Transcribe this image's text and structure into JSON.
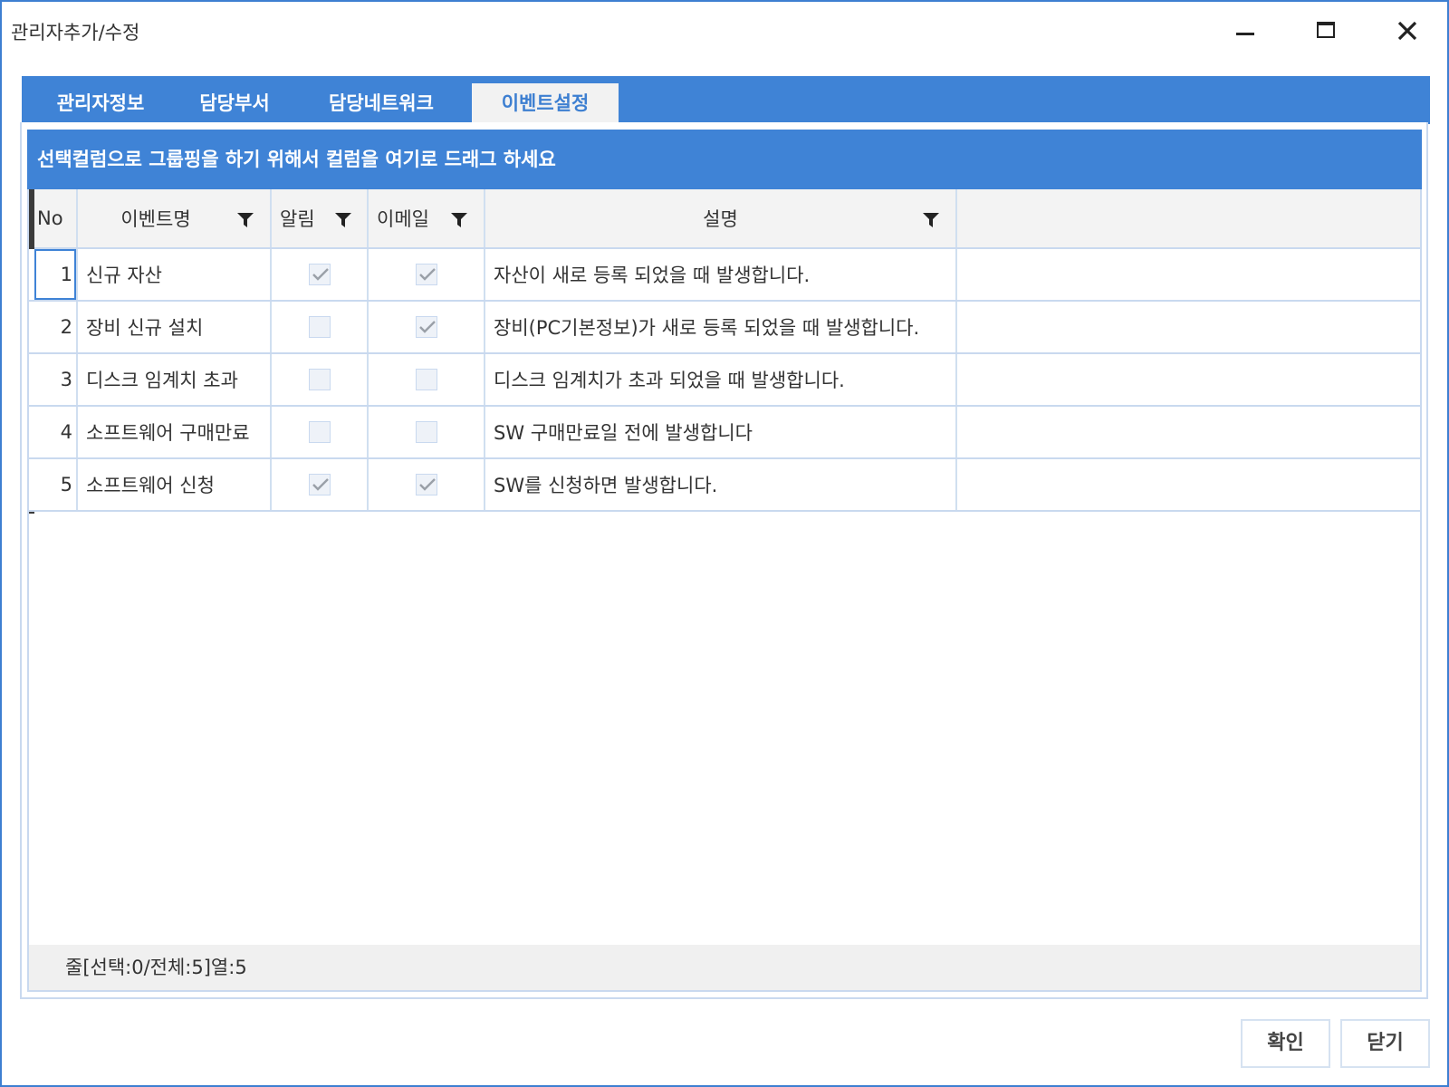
{
  "window": {
    "title": "관리자추가/수정"
  },
  "tabs": [
    {
      "label": "관리자정보",
      "active": false
    },
    {
      "label": "담당부서",
      "active": false
    },
    {
      "label": "담당네트워크",
      "active": false
    },
    {
      "label": "이벤트설정",
      "active": true
    }
  ],
  "group_panel": {
    "text": "선택컬럼으로 그룹핑을 하기 위해서 컬럼을 여기로 드래그 하세요"
  },
  "grid": {
    "columns": {
      "no": "No",
      "name": "이벤트명",
      "alert": "알림",
      "email": "이메일",
      "desc": "설명"
    },
    "rows": [
      {
        "no": "1",
        "name": "신규 자산",
        "alert": true,
        "email": true,
        "desc": "자산이 새로 등록 되었을 때 발생합니다."
      },
      {
        "no": "2",
        "name": "장비 신규 설치",
        "alert": false,
        "email": true,
        "desc": "장비(PC기본정보)가 새로 등록 되었을 때 발생합니다."
      },
      {
        "no": "3",
        "name": "디스크 임계치 초과",
        "alert": false,
        "email": false,
        "desc": "디스크 임계치가 초과 되었을 때 발생합니다."
      },
      {
        "no": "4",
        "name": "소프트웨어 구매만료",
        "alert": false,
        "email": false,
        "desc": "SW 구매만료일 전에 발생합니다"
      },
      {
        "no": "5",
        "name": "소프트웨어 신청",
        "alert": true,
        "email": true,
        "desc": "SW를 신청하면 발생합니다."
      }
    ],
    "status": "줄[선택:0/전체:5]열:5"
  },
  "buttons": {
    "ok": "확인",
    "close": "닫기"
  },
  "colors": {
    "accent": "#3f83d6",
    "border": "#c9d9ef",
    "header_bg": "#f3f3f3"
  }
}
